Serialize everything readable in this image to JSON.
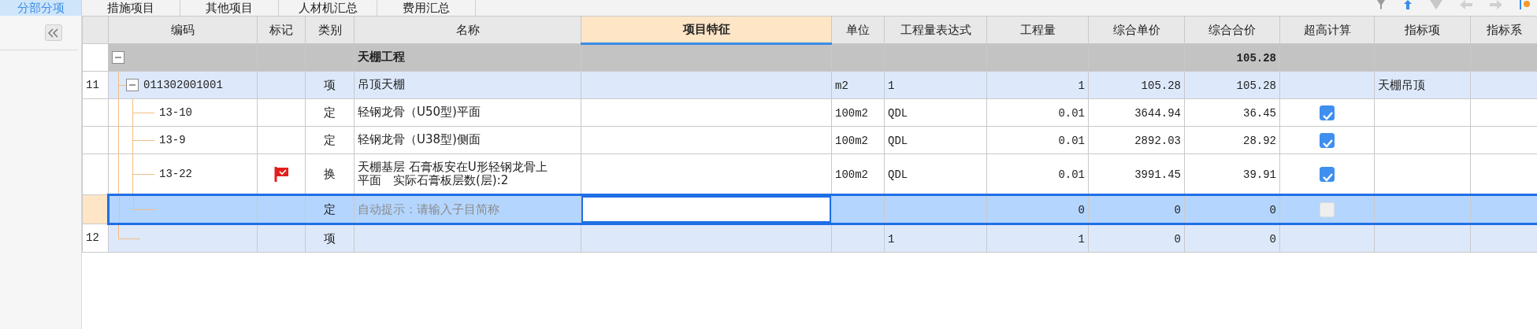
{
  "tabs": [
    {
      "label": "分部分项",
      "selected": true
    },
    {
      "label": "措施项目",
      "selected": false
    },
    {
      "label": "其他项目",
      "selected": false
    },
    {
      "label": "人材机汇总",
      "selected": false
    },
    {
      "label": "费用汇总",
      "selected": false
    }
  ],
  "columns": [
    {
      "label": "编码",
      "selected": false
    },
    {
      "label": "标记",
      "selected": false
    },
    {
      "label": "类别",
      "selected": false
    },
    {
      "label": "名称",
      "selected": false
    },
    {
      "label": "项目特征",
      "selected": true
    },
    {
      "label": "单位",
      "selected": false
    },
    {
      "label": "工程量表达式",
      "selected": false
    },
    {
      "label": "工程量",
      "selected": false
    },
    {
      "label": "综合单价",
      "selected": false
    },
    {
      "label": "综合合价",
      "selected": false
    },
    {
      "label": "超高计算",
      "selected": false
    },
    {
      "label": "指标项",
      "selected": false
    },
    {
      "label": "指标系",
      "selected": false
    }
  ],
  "rows": [
    {
      "kind": "group",
      "expanded": true,
      "selected": false,
      "flagged": false,
      "name": "天棚工程",
      "total": "105.28",
      "children": [
        {
          "kind": "item",
          "number": "11",
          "code": "011302001001",
          "expanded": true,
          "selected": false,
          "flagged": false,
          "type": "项",
          "name": "吊顶天棚",
          "unit": "m2",
          "expression": "1",
          "quantity": "1",
          "unit_price": "105.28",
          "total": "105.28",
          "index_item": "天棚吊顶",
          "children": [
            {
              "kind": "sub",
              "code": "13-10",
              "selected": false,
              "flagged": false,
              "type": "定",
              "name": "轻钢龙骨（U50型)平面",
              "unit": "100m2",
              "expression": "QDL",
              "quantity": "0.01",
              "unit_price": "3644.94",
              "total": "36.45",
              "over_height": {
                "checked": true,
                "disabled": false
              }
            },
            {
              "kind": "sub",
              "code": "13-9",
              "selected": false,
              "flagged": false,
              "type": "定",
              "name": "轻钢龙骨（U38型)侧面",
              "unit": "100m2",
              "expression": "QDL",
              "quantity": "0.01",
              "unit_price": "2892.03",
              "total": "28.92",
              "over_height": {
                "checked": true,
                "disabled": false
              }
            },
            {
              "kind": "sub",
              "code": "13-22",
              "selected": false,
              "flagged": true,
              "type": "换",
              "name": "天棚基层 石膏板安在U形轻钢龙骨上平面　实际石膏板层数(层):2",
              "unit": "100m2",
              "expression": "QDL",
              "quantity": "0.01",
              "unit_price": "3991.45",
              "total": "39.91",
              "over_height": {
                "checked": true,
                "disabled": false
              }
            },
            {
              "kind": "sub",
              "selected": true,
              "flagged": false,
              "type": "定",
              "placeholder": "自动提示：请输入子目简称",
              "quantity": "0",
              "unit_price": "0",
              "total": "0",
              "over_height": {
                "checked": false,
                "disabled": true
              }
            }
          ]
        },
        {
          "kind": "item",
          "number": "12",
          "selected": false,
          "flagged": false,
          "type": "项",
          "expression": "1",
          "quantity": "1",
          "unit_price": "0",
          "total": "0"
        }
      ]
    }
  ]
}
